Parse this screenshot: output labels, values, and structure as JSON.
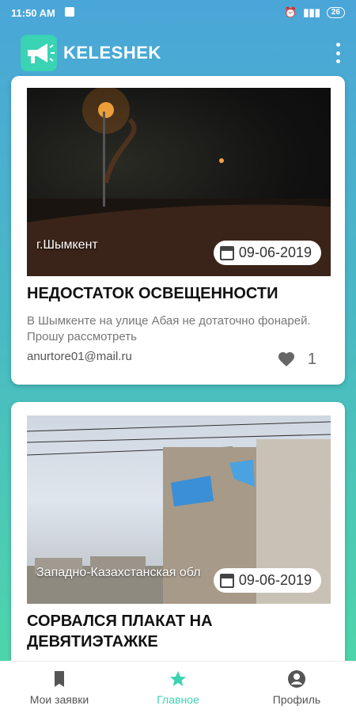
{
  "status": {
    "time": "11:50 AM",
    "battery": "26"
  },
  "app": {
    "title": "KELESHEK"
  },
  "posts": [
    {
      "location": "г.Шымкент",
      "date": "09-06-2019",
      "title": "НЕДОСТАТОК ОСВЕЩЕННОСТИ",
      "description": "В Шымкенте на улице Абая не дотаточно фонарей. Прошу рассмотреть",
      "email": "anurtore01@mail.ru",
      "likes": "1"
    },
    {
      "location": "Западно-Казахстанская обл",
      "date": "09-06-2019",
      "title": "СОРВАЛСЯ ПЛАКАТ НА ДЕВЯТИЭТАЖКЕ"
    }
  ],
  "nav": [
    {
      "label": "Мои заявки",
      "icon": "bookmark-icon"
    },
    {
      "label": "Главное",
      "icon": "star-icon"
    },
    {
      "label": "Профиль",
      "icon": "account-icon"
    }
  ],
  "colors": {
    "accent": "#3ad3b3",
    "header": "#4aa6d8"
  }
}
